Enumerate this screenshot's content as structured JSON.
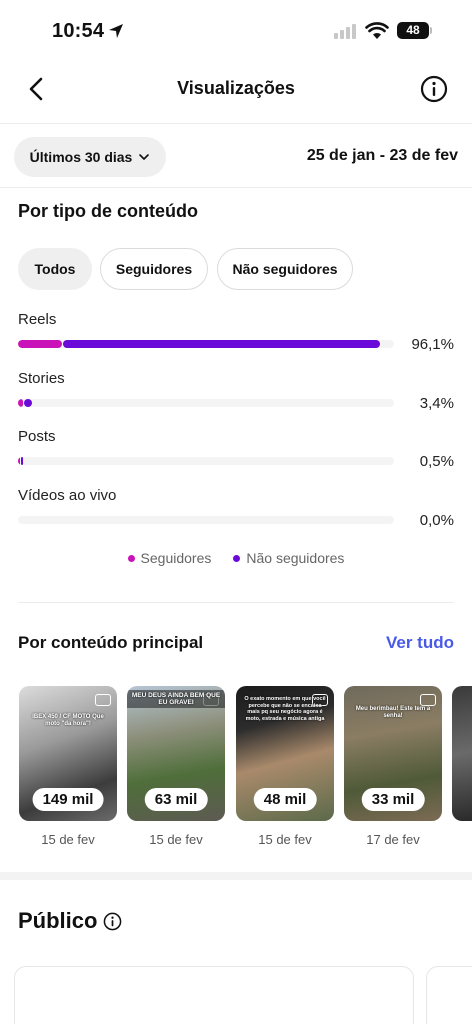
{
  "status_bar": {
    "time": "10:54",
    "battery": "48"
  },
  "header": {
    "title": "Visualizações"
  },
  "filter": {
    "period": "Últimos 30 dias",
    "date_range": "25 de jan - 23 de fev"
  },
  "content_type": {
    "title": "Por tipo de conteúdo",
    "tabs": [
      {
        "label": "Todos",
        "active": true
      },
      {
        "label": "Seguidores",
        "active": false
      },
      {
        "label": "Não seguidores",
        "active": false
      }
    ],
    "metrics": [
      {
        "label": "Reels",
        "value": "96,1%",
        "followers_share": 0.117,
        "non_followers_share": 0.844
      },
      {
        "label": "Stories",
        "value": "3,4%",
        "followers_share": 0.012,
        "non_followers_share": 0.022
      },
      {
        "label": "Posts",
        "value": "0,5%",
        "followers_share": 0.002,
        "non_followers_share": 0.003
      },
      {
        "label": "Vídeos ao vivo",
        "value": "0,0%",
        "followers_share": 0,
        "non_followers_share": 0
      }
    ],
    "legend": {
      "followers": "Seguidores",
      "non_followers": "Não seguidores"
    },
    "colors": {
      "followers": "#c913b9",
      "non_followers": "#6a0ad8"
    }
  },
  "top_content": {
    "title": "Por conteúdo principal",
    "see_all": "Ver tudo",
    "items": [
      {
        "caption": "IBEX 450 / CF MOTO Que moto \"da hora\"!",
        "views": "149 mil",
        "date": "15 de fev"
      },
      {
        "caption": "MEU DEUS AINDA BEM QUE EU GRAVEI",
        "views": "63 mil",
        "date": "15 de fev"
      },
      {
        "caption": "O exato momento em que você percebe que não se encaixa mais pq seu negócio agora é moto, estrada e música antiga",
        "views": "48 mil",
        "date": "15 de fev"
      },
      {
        "caption": "Meu berimbau! Este tem a senha!",
        "views": "33 mil",
        "date": "17 de fev"
      }
    ]
  },
  "audience": {
    "title": "Público"
  }
}
